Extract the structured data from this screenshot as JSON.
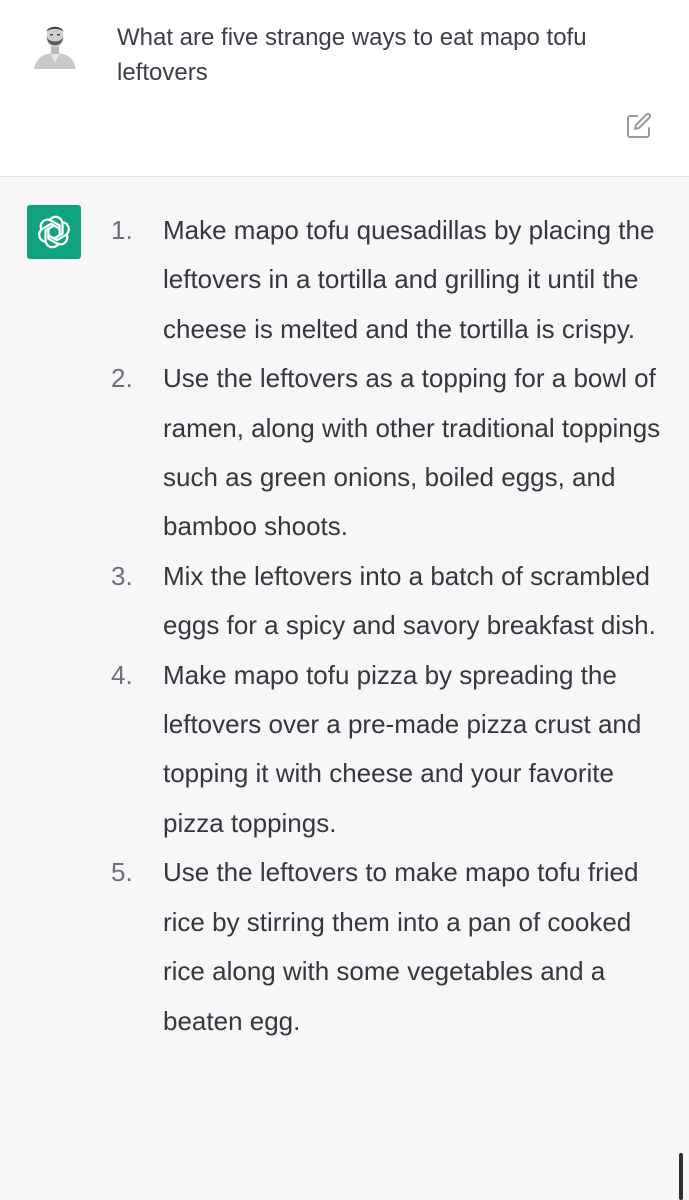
{
  "conversation": {
    "user_message": {
      "avatar_icon": "user-avatar-photo",
      "text": "What are five strange ways to eat mapo tofu leftovers",
      "edit_icon": "edit-icon"
    },
    "assistant_message": {
      "avatar_icon": "openai-logo-icon",
      "avatar_color": "#10a37f",
      "items": [
        {
          "number": "1.",
          "text": "Make mapo tofu quesadillas by placing the leftovers in a tortilla and grilling it until the cheese is melted and the tortilla is crispy."
        },
        {
          "number": "2.",
          "text": "Use the leftovers as a topping for a bowl of ramen, along with other traditional toppings such as green onions, boiled eggs, and bamboo shoots."
        },
        {
          "number": "3.",
          "text": "Mix the leftovers into a batch of scrambled eggs for a spicy and savory breakfast dish."
        },
        {
          "number": "4.",
          "text": "Make mapo tofu pizza by spreading the leftovers over a pre-made pizza crust and topping it with cheese and your favorite pizza toppings."
        },
        {
          "number": "5.",
          "text": "Use the leftovers to make mapo tofu fried rice by stirring them into a pan of cooked rice along with some vegetables and a beaten egg."
        }
      ]
    }
  },
  "colors": {
    "user_background": "#ffffff",
    "assistant_background": "#f7f7f8",
    "text": "#353740",
    "number": "#6e6e80"
  }
}
